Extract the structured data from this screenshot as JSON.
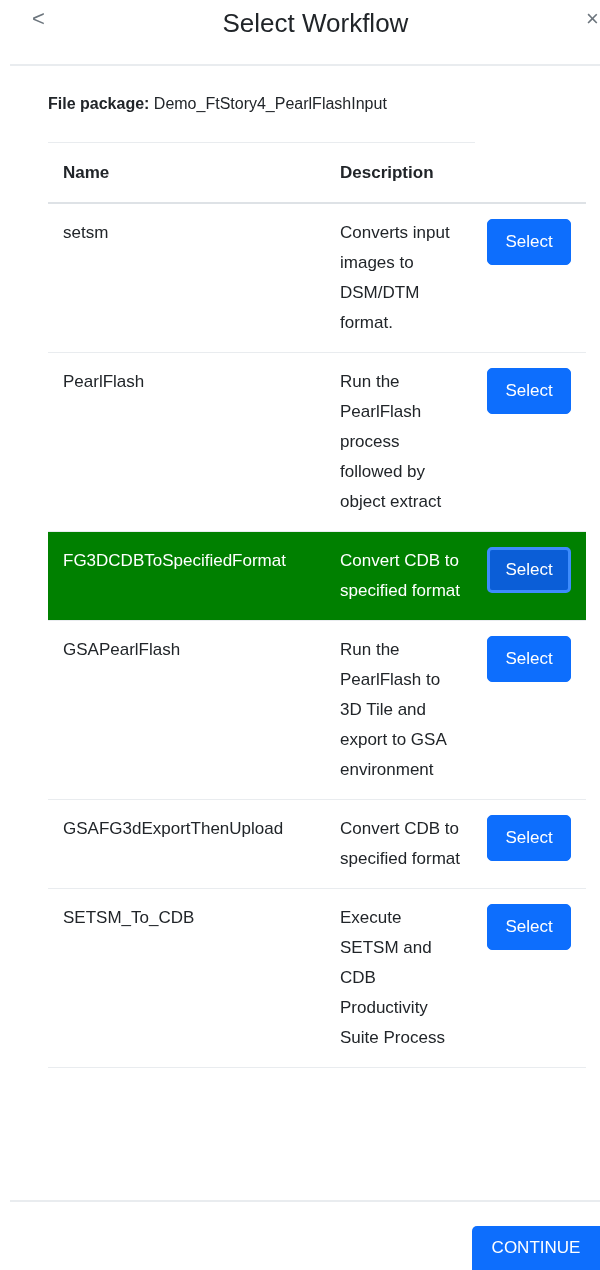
{
  "header": {
    "back": "<",
    "title": "Select Workflow",
    "close": "×"
  },
  "file_package": {
    "label": "File package:",
    "value": "Demo_FtStory4_PearlFlashInput"
  },
  "table": {
    "columns": [
      "Name",
      "Description"
    ],
    "rows": [
      {
        "name": "setsm",
        "description": "Converts input images to DSM/DTM format.",
        "action": "Select",
        "selected": false
      },
      {
        "name": "PearlFlash",
        "description": "Run the PearlFlash process followed by object extract",
        "action": "Select",
        "selected": false
      },
      {
        "name": "FG3DCDBToSpecifiedFormat",
        "description": "Convert CDB to specified format",
        "action": "Select",
        "selected": true
      },
      {
        "name": "GSAPearlFlash",
        "description": "Run the PearlFlash to 3D Tile and export to GSA environment",
        "action": "Select",
        "selected": false
      },
      {
        "name": "GSAFG3dExportThenUpload",
        "description": "Convert CDB to specified format",
        "action": "Select",
        "selected": false
      },
      {
        "name": "SETSM_To_CDB",
        "description": "Execute SETSM and CDB Productivity Suite Process",
        "action": "Select",
        "selected": false
      }
    ]
  },
  "footer": {
    "button": "CONTINUE"
  }
}
